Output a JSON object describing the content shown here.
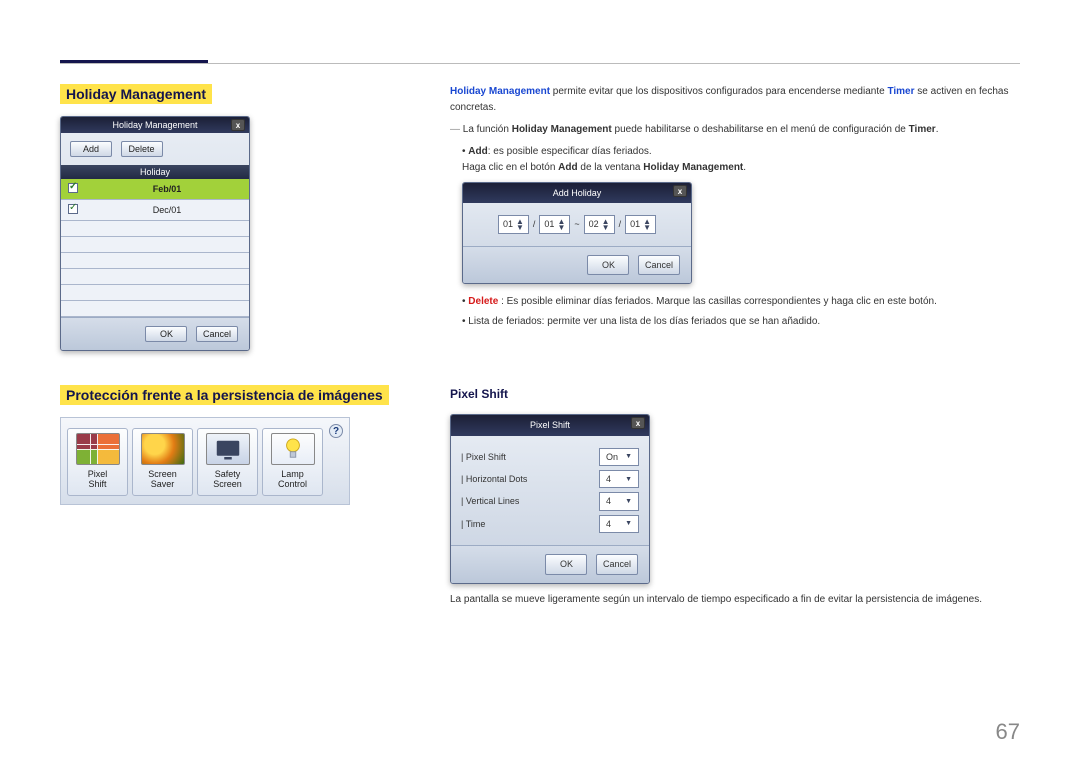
{
  "page_number": "67",
  "section1": {
    "title": "Holiday Management",
    "intro_a": "Holiday Management",
    "intro_b": " permite evitar que los dispositivos configurados para encenderse mediante ",
    "intro_c": "Timer",
    "intro_d": " se activen en fechas concretas.",
    "note_a": "La función ",
    "note_b": "Holiday Management",
    "note_c": " puede habilitarse o deshabilitarse en el menú de configuración de ",
    "note_d": "Timer",
    "note_e": ".",
    "bullet_add_a": "Add",
    "bullet_add_b": ": es posible especificar días feriados.",
    "bullet_add_c": "Haga clic en el botón ",
    "bullet_add_d": "Add",
    "bullet_add_e": " de la ventana ",
    "bullet_add_f": "Holiday Management",
    "bullet_add_g": ".",
    "bullet_delete_a": "Delete",
    "bullet_delete_b": " : Es posible eliminar días feriados. Marque las casillas correspondientes y haga clic en este botón.",
    "bullet_list": "Lista de feriados: permite ver una lista de los días feriados que se han añadido."
  },
  "holiday_dialog": {
    "title": "Holiday Management",
    "add": "Add",
    "delete": "Delete",
    "header": "Holiday",
    "row1": "Feb/01",
    "row2": "Dec/01",
    "ok": "OK",
    "cancel": "Cancel"
  },
  "add_holiday_dialog": {
    "title": "Add Holiday",
    "m1": "01",
    "d1": "01",
    "sep": "~",
    "m2": "02",
    "d2": "01",
    "ok": "OK",
    "cancel": "Cancel"
  },
  "section2": {
    "title": "Protección frente a la persistencia de imágenes",
    "pixel_shift_heading": "Pixel Shift",
    "caption": "La pantalla se mueve ligeramente según un intervalo de tiempo especificado a fin de evitar la persistencia de imágenes."
  },
  "thumb_panel": {
    "help": "?",
    "items": [
      {
        "line1": "Pixel",
        "line2": "Shift"
      },
      {
        "line1": "Screen",
        "line2": "Saver"
      },
      {
        "line1": "Safety",
        "line2": "Screen"
      },
      {
        "line1": "Lamp",
        "line2": "Control"
      }
    ]
  },
  "pixel_shift_dialog": {
    "title": "Pixel Shift",
    "rows": [
      {
        "label": "Pixel Shift",
        "value": "On"
      },
      {
        "label": "Horizontal Dots",
        "value": "4"
      },
      {
        "label": "Vertical Lines",
        "value": "4"
      },
      {
        "label": "Time",
        "value": "4"
      }
    ],
    "ok": "OK",
    "cancel": "Cancel"
  }
}
